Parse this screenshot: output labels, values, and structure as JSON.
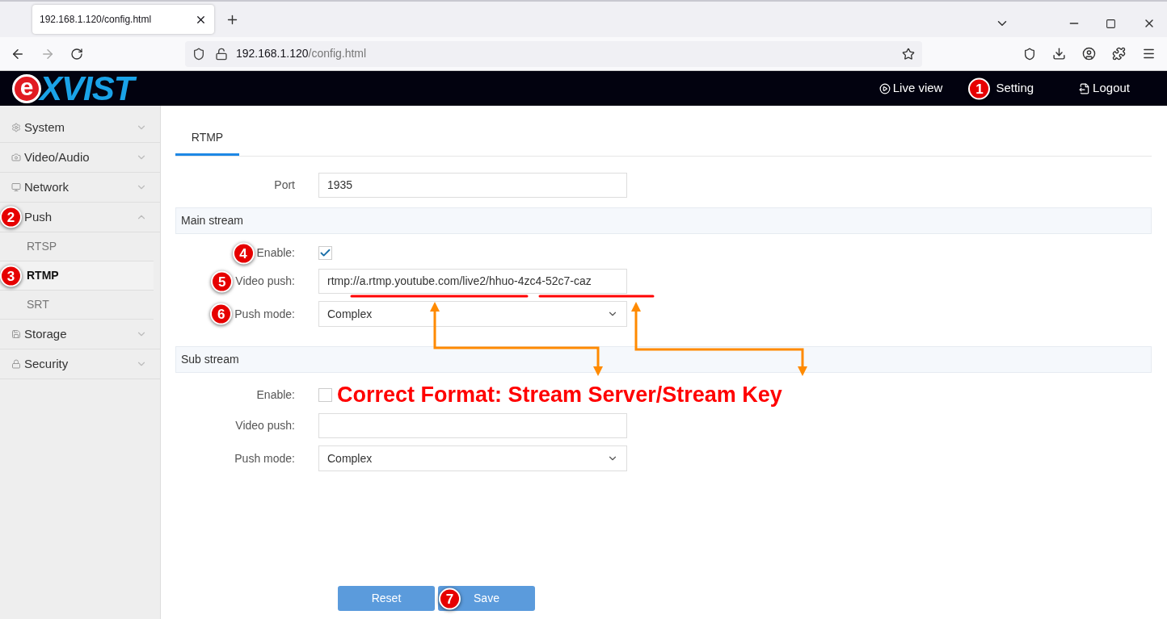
{
  "browser": {
    "tab_title": "192.168.1.120/config.html",
    "url_host": "192.168.1.120",
    "url_path": "/config.html"
  },
  "header": {
    "logo_letter": "e",
    "logo_rest": "XVIST",
    "nav": [
      {
        "label": "Live view"
      },
      {
        "label": "Setting",
        "marker": "1"
      },
      {
        "label": "Logout"
      }
    ]
  },
  "sidebar": {
    "items": [
      {
        "label": "System",
        "expanded": false
      },
      {
        "label": "Video/Audio",
        "expanded": false
      },
      {
        "label": "Network",
        "expanded": false
      },
      {
        "label": "Push",
        "expanded": true,
        "marker": "2",
        "children": [
          {
            "label": "RTSP",
            "selected": false
          },
          {
            "label": "RTMP",
            "selected": true,
            "marker": "3"
          },
          {
            "label": "SRT",
            "selected": false
          }
        ]
      },
      {
        "label": "Storage",
        "expanded": false
      },
      {
        "label": "Security",
        "expanded": false
      }
    ]
  },
  "tabs": [
    {
      "label": "RTMP",
      "selected": true
    }
  ],
  "port": {
    "label": "Port",
    "value": "1935"
  },
  "sections": [
    {
      "title": "Main stream",
      "enable": {
        "label": "Enable:",
        "checked": true,
        "marker": "4"
      },
      "video_push": {
        "label": "Video push:",
        "value": "rtmp://a.rtmp.youtube.com/live2/hhuo-4zc4-52c7-caz",
        "marker": "5"
      },
      "push_mode": {
        "label": "Push mode:",
        "value": "Complex",
        "marker": "6"
      }
    },
    {
      "title": "Sub stream",
      "enable": {
        "label": "Enable:",
        "checked": false
      },
      "video_push": {
        "label": "Video push:"
      },
      "push_mode": {
        "label": "Push mode:",
        "value": "Complex"
      }
    }
  ],
  "note": "Correct Format: Stream Server/Stream Key",
  "buttons": [
    {
      "label": "Reset"
    },
    {
      "label": "Save",
      "marker": "7"
    }
  ]
}
